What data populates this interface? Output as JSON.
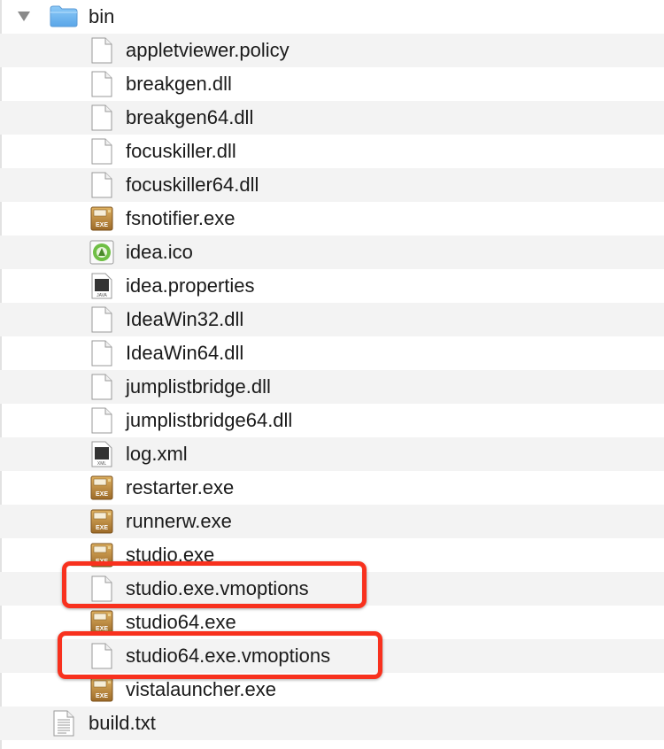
{
  "folder": {
    "name": "bin",
    "icon": "folder-icon",
    "disclosure": "disclosure-triangle-open-icon"
  },
  "files": [
    {
      "name": "appletviewer.policy",
      "icon": "document-icon"
    },
    {
      "name": "breakgen.dll",
      "icon": "document-icon"
    },
    {
      "name": "breakgen64.dll",
      "icon": "document-icon"
    },
    {
      "name": "focuskiller.dll",
      "icon": "document-icon"
    },
    {
      "name": "focuskiller64.dll",
      "icon": "document-icon"
    },
    {
      "name": "fsnotifier.exe",
      "icon": "exe-icon",
      "badge": "EXE"
    },
    {
      "name": "idea.ico",
      "icon": "ico-image-icon"
    },
    {
      "name": "idea.properties",
      "icon": "java-file-icon",
      "badge": "JAVA"
    },
    {
      "name": "IdeaWin32.dll",
      "icon": "document-icon"
    },
    {
      "name": "IdeaWin64.dll",
      "icon": "document-icon"
    },
    {
      "name": "jumplistbridge.dll",
      "icon": "document-icon"
    },
    {
      "name": "jumplistbridge64.dll",
      "icon": "document-icon"
    },
    {
      "name": "log.xml",
      "icon": "xml-file-icon",
      "badge": "XML"
    },
    {
      "name": "restarter.exe",
      "icon": "exe-icon",
      "badge": "EXE"
    },
    {
      "name": "runnerw.exe",
      "icon": "exe-icon",
      "badge": "EXE"
    },
    {
      "name": "studio.exe",
      "icon": "exe-icon",
      "badge": "EXE"
    },
    {
      "name": "studio.exe.vmoptions",
      "icon": "document-icon",
      "highlighted": true
    },
    {
      "name": "studio64.exe",
      "icon": "exe-icon",
      "badge": "EXE"
    },
    {
      "name": "studio64.exe.vmoptions",
      "icon": "document-icon",
      "highlighted": true
    },
    {
      "name": "vistalauncher.exe",
      "icon": "exe-icon",
      "badge": "EXE"
    }
  ],
  "sibling": {
    "name": "build.txt",
    "icon": "text-document-icon"
  },
  "colors": {
    "highlight": "#f8311e",
    "alt_row": "#f3f3f3",
    "folder": "#74b9f1"
  }
}
